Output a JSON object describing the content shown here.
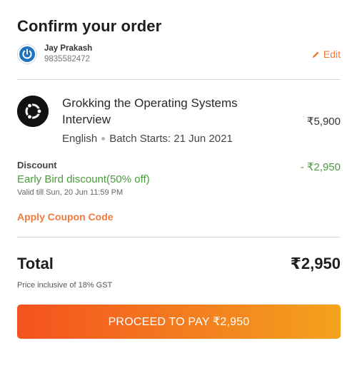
{
  "page": {
    "title": "Confirm your order"
  },
  "user": {
    "name": "Jay Prakash",
    "phone": "9835582472",
    "edit_label": "Edit"
  },
  "course": {
    "title": "Grokking the Operating Systems Interview",
    "language": "English",
    "batch": "Batch Starts: 21 Jun 2021",
    "price": "₹5,900"
  },
  "discount": {
    "label": "Discount",
    "name": "Early Bird discount(50% off)",
    "valid_till": "Valid till Sun, 20 Jun 11:59 PM",
    "amount": "- ₹2,950"
  },
  "coupon": {
    "label": "Apply Coupon Code"
  },
  "total": {
    "label": "Total",
    "amount": "₹2,950",
    "gst_note": "Price inclusive of 18% GST"
  },
  "actions": {
    "pay_label": "PROCEED TO PAY ₹2,950"
  },
  "colors": {
    "accent": "#ee7b3b",
    "discount": "#4b9a3c",
    "button_start": "#f4511e",
    "button_end": "#f4a21d"
  }
}
